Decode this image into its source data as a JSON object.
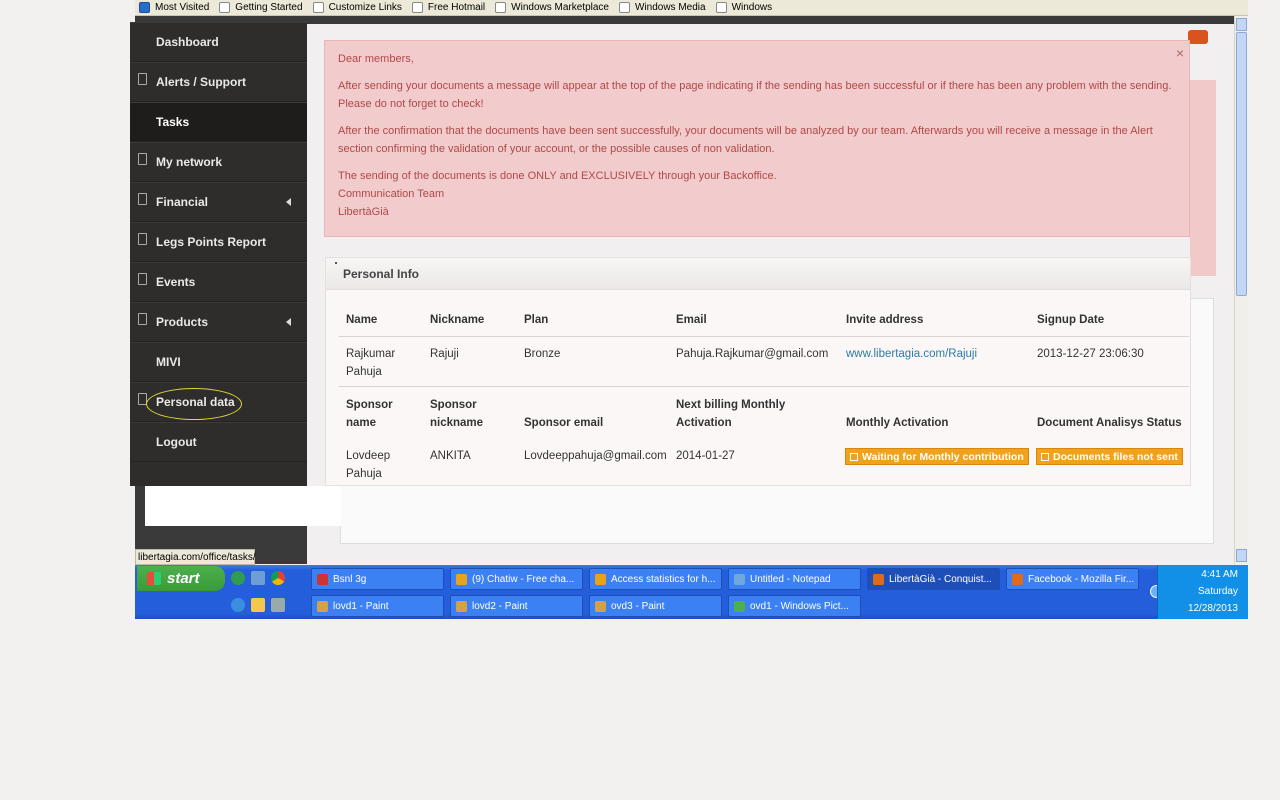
{
  "bookmarks": [
    "Most Visited",
    "Getting Started",
    "Customize Links",
    "Free Hotmail",
    "Windows Marketplace",
    "Windows Media",
    "Windows"
  ],
  "sidebar": {
    "items": [
      {
        "label": "Dashboard"
      },
      {
        "label": "Alerts / Support"
      },
      {
        "label": "Tasks"
      },
      {
        "label": "My network"
      },
      {
        "label": "Financial"
      },
      {
        "label": "Legs Points Report"
      },
      {
        "label": "Events"
      },
      {
        "label": "Products"
      },
      {
        "label": "MIVI"
      },
      {
        "label": "Personal data"
      },
      {
        "label": "Logout"
      }
    ]
  },
  "alert": {
    "close": "×",
    "greeting": "Dear members,",
    "p1": "After sending your documents a message will appear at the top of the page indicating if the sending has been successful or if there has been any problem with the sending. Please do not forget to check!",
    "p2": "After the confirmation that the documents have been sent successfully, your documents will be analyzed by our team. Afterwards you will receive a message in the Alert section confirming the validation of your account, or the possible causes of non validation.",
    "p3": "The sending of the documents is done ONLY and EXCLUSIVELY through your Backoffice.",
    "sig1": "Communication Team",
    "sig2": "LibertàGià"
  },
  "personal_info": {
    "title": "Personal Info",
    "headers1": [
      "Name",
      "Nickname",
      "Plan",
      "Email",
      "Invite address",
      "Signup Date"
    ],
    "row1": {
      "name": "Rajkumar Pahuja",
      "nickname": "Rajuji",
      "plan": "Bronze",
      "email": "Pahuja.Rajkumar@gmail.com",
      "invite": "www.libertagia.com/Rajuji",
      "signup": "2013-12-27 23:06:30"
    },
    "headers2": [
      "Sponsor name",
      "Sponsor nickname",
      "Sponsor email",
      "Next billing Monthly Activation",
      "Monthly Activation",
      "Document Analisys Status"
    ],
    "row2": {
      "sponsor_name": "Lovdeep Pahuja",
      "sponsor_nickname": "ANKITA",
      "sponsor_email": "Lovdeeppahuja@gmail.com",
      "next_billing": "2014-01-27",
      "monthly_badge": "Waiting for Monthly contribution",
      "doc_badge": "Documents files not sent"
    }
  },
  "statusbar": "libertagia.com/office/tasks/",
  "taskbar": {
    "start": "start",
    "row1": [
      {
        "label": "Bsnl 3g",
        "color": "#cc3333"
      },
      {
        "label": "(9) Chatiw - Free cha...",
        "color": "#e8a31c"
      },
      {
        "label": "Access statistics for h...",
        "color": "#e8a31c"
      },
      {
        "label": "Untitled - Notepad",
        "color": "#6fa8dc"
      },
      {
        "label": "LibertàGià - Conquist...",
        "color": "#e06a1c"
      },
      {
        "label": "Facebook - Mozilla Fir...",
        "color": "#e06a1c"
      }
    ],
    "row2": [
      {
        "label": "lovd1 - Paint",
        "color": "#d4a04a"
      },
      {
        "label": "lovd2 - Paint",
        "color": "#d4a04a"
      },
      {
        "label": "ovd3 - Paint",
        "color": "#d4a04a"
      },
      {
        "label": "ovd1 - Windows Pict...",
        "color": "#4caf50"
      }
    ],
    "clock": {
      "time": "4:41 AM",
      "day": "Saturday",
      "date": "12/28/2013"
    }
  }
}
